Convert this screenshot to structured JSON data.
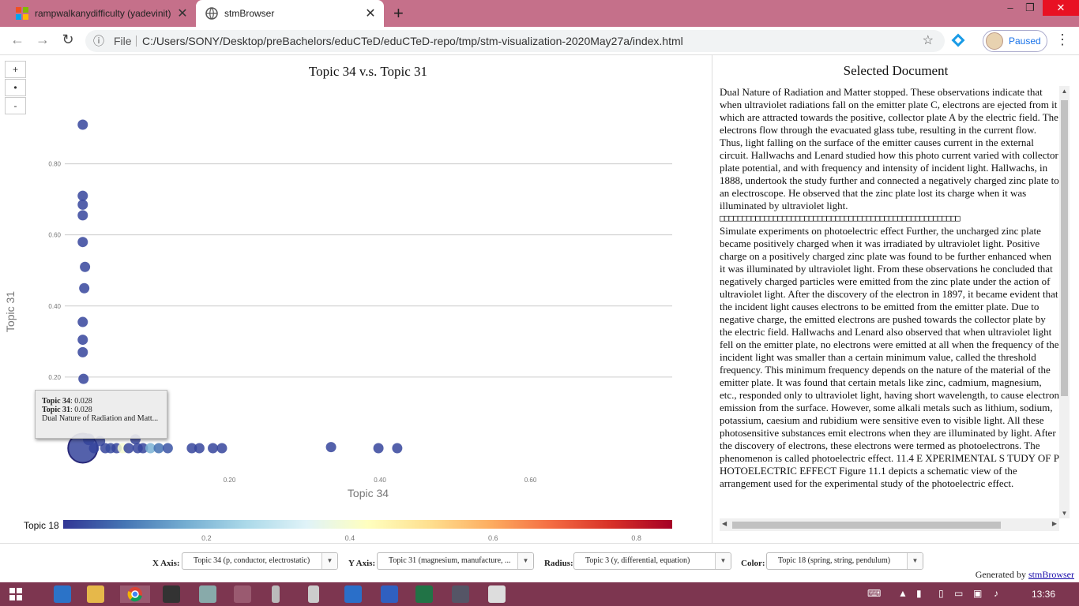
{
  "browser": {
    "tabs": [
      {
        "title": "rampwalkanydifficulty (yadevinit)"
      },
      {
        "title": "stmBrowser"
      }
    ],
    "url_scheme_label": "File",
    "url": "C:/Users/SONY/Desktop/preBachelors/eduCTeD/eduCTeD-repo/tmp/stm-visualization-2020May27a/index.html",
    "profile_status": "Paused"
  },
  "zoom": {
    "in": "+",
    "reset": "•",
    "out": "-"
  },
  "chart_data": {
    "type": "scatter",
    "title": "Topic 34 v.s. Topic 31",
    "xlabel": "Topic 34",
    "ylabel": "Topic 31",
    "xlim": [
      0.0,
      0.8
    ],
    "ylim": [
      -0.02,
      0.95
    ],
    "x_ticks": [
      "0.20",
      "0.40",
      "0.60"
    ],
    "y_ticks": [
      "0.20",
      "0.40",
      "0.60",
      "0.80"
    ],
    "color_label": "Topic 18",
    "color_ticks": [
      "0.2",
      "0.4",
      "0.6",
      "0.8"
    ],
    "color_range": [
      0.0,
      0.85
    ],
    "points": [
      {
        "x": 0.005,
        "y": 0.91,
        "r": 0.05,
        "c": 0.02
      },
      {
        "x": 0.005,
        "y": 0.71,
        "r": 0.05,
        "c": 0.02
      },
      {
        "x": 0.005,
        "y": 0.685,
        "r": 0.05,
        "c": 0.02
      },
      {
        "x": 0.005,
        "y": 0.655,
        "r": 0.05,
        "c": 0.02
      },
      {
        "x": 0.005,
        "y": 0.58,
        "r": 0.05,
        "c": 0.02
      },
      {
        "x": 0.008,
        "y": 0.51,
        "r": 0.05,
        "c": 0.02
      },
      {
        "x": 0.007,
        "y": 0.45,
        "r": 0.05,
        "c": 0.02
      },
      {
        "x": 0.005,
        "y": 0.355,
        "r": 0.05,
        "c": 0.02
      },
      {
        "x": 0.005,
        "y": 0.305,
        "r": 0.05,
        "c": 0.02
      },
      {
        "x": 0.005,
        "y": 0.27,
        "r": 0.05,
        "c": 0.02
      },
      {
        "x": 0.006,
        "y": 0.195,
        "r": 0.05,
        "c": 0.02
      },
      {
        "x": 0.005,
        "y": 0.0,
        "r": 0.45,
        "c": 0.02
      },
      {
        "x": 0.013,
        "y": 0.025,
        "r": 0.08,
        "c": 0.02
      },
      {
        "x": 0.02,
        "y": 0.0,
        "r": 0.05,
        "c": 0.02
      },
      {
        "x": 0.028,
        "y": 0.02,
        "r": 0.05,
        "c": 0.02
      },
      {
        "x": 0.035,
        "y": 0.0,
        "r": 0.05,
        "c": 0.02
      },
      {
        "x": 0.042,
        "y": 0.0,
        "r": 0.05,
        "c": 0.03
      },
      {
        "x": 0.05,
        "y": 0.0,
        "r": 0.05,
        "c": 0.02
      },
      {
        "x": 0.058,
        "y": 0.0,
        "r": 0.05,
        "c": 0.4
      },
      {
        "x": 0.066,
        "y": 0.0,
        "r": 0.05,
        "c": 0.02
      },
      {
        "x": 0.075,
        "y": 0.025,
        "r": 0.05,
        "c": 0.02
      },
      {
        "x": 0.078,
        "y": 0.0,
        "r": 0.05,
        "c": 0.02
      },
      {
        "x": 0.085,
        "y": 0.0,
        "r": 0.05,
        "c": 0.02
      },
      {
        "x": 0.095,
        "y": 0.0,
        "r": 0.05,
        "c": 0.18
      },
      {
        "x": 0.106,
        "y": 0.0,
        "r": 0.05,
        "c": 0.08
      },
      {
        "x": 0.118,
        "y": 0.0,
        "r": 0.05,
        "c": 0.04
      },
      {
        "x": 0.15,
        "y": 0.0,
        "r": 0.05,
        "c": 0.02
      },
      {
        "x": 0.16,
        "y": 0.0,
        "r": 0.05,
        "c": 0.02
      },
      {
        "x": 0.178,
        "y": 0.0,
        "r": 0.05,
        "c": 0.02
      },
      {
        "x": 0.19,
        "y": 0.0,
        "r": 0.05,
        "c": 0.02
      },
      {
        "x": 0.335,
        "y": 0.003,
        "r": 0.05,
        "c": 0.02
      },
      {
        "x": 0.398,
        "y": 0.0,
        "r": 0.05,
        "c": 0.02
      },
      {
        "x": 0.423,
        "y": 0.0,
        "r": 0.05,
        "c": 0.02
      }
    ]
  },
  "tooltip": {
    "x_label": "Topic 34",
    "x_value": ": 0.028",
    "y_label": "Topic 31",
    "y_value": ": 0.028",
    "doc": "Dual Nature of Radiation and Matt..."
  },
  "document": {
    "heading": "Selected Document",
    "para1": "Dual Nature of Radiation and Matter stopped. These observations indicate that when ultraviolet radiations fall on the emitter plate C, electrons are ejected from it which are attracted towards the positive, collector plate A by the electric field. The electrons flow through the evacuated glass tube, resulting in the current flow. Thus, light falling on the surface of the emitter causes current in the external circuit. Hallwachs and Lenard studied how this photo current varied with collector plate potential, and with frequency and intensity of incident light. Hallwachs, in 1888, undertook the study further and connected a negatively charged zinc plate to an electroscope. He observed that the zinc plate lost its charge when it was illuminated by ultraviolet light.",
    "boxes": "□□□□□□□□□□□□□□□□□□□□□□□□□□□□□□□□□□□□□□□□□□□□□□□□□□□□□□",
    "para2": "Simulate experiments on photoelectric effect Further, the uncharged zinc plate became positively charged when it was irradiated by ultraviolet light. Positive charge on a positively charged zinc plate was found to be further enhanced when it was illuminated by ultraviolet light. From these observations he concluded that negatively charged particles were emitted from the zinc plate under the action of ultraviolet light. After the discovery of the electron in 1897, it became evident that the incident light causes electrons to be emitted from the emitter plate. Due to negative charge, the emitted electrons are pushed towards the collector plate by the electric field. Hallwachs and Lenard also observed that when ultraviolet light fell on the emitter plate, no electrons were emitted at all when the frequency of the incident light was smaller than a certain minimum value, called the threshold frequency. This minimum frequency depends on the nature of the material of the emitter plate. It was found that certain metals like zinc, cadmium, magnesium, etc., responded only to ultraviolet light, having short wavelength, to cause electron emission from the surface. However, some alkali metals such as lithium, sodium, potassium, caesium and rubidium were sensitive even to visible light. All these photosensitive substances emit electrons when they are illuminated by light. After the discovery of electrons, these electrons were termed as photoelectrons. The phenomenon is called photoelectric effect. 11.4 E XPERIMENTAL S TUDY OF P HOTOELECTRIC EFFECT Figure 11.1 depicts a schematic view of the arrangement used for the experimental study of the photoelectric effect."
  },
  "controls": {
    "x_axis_label": "X Axis:",
    "x_axis_value": "Topic 34 (p, conductor, electrostatic)",
    "y_axis_label": "Y Axis:",
    "y_axis_value": "Topic 31 (magnesium, manufacture, ...",
    "radius_label": "Radius:",
    "radius_value": "Topic 3 (y, differential, equation)",
    "color_label": "Color:",
    "color_value": "Topic 18 (spring, string, pendulum)",
    "generated_prefix": "Generated by ",
    "generated_link": "stmBrowser"
  },
  "taskbar": {
    "clock": "13:36"
  }
}
